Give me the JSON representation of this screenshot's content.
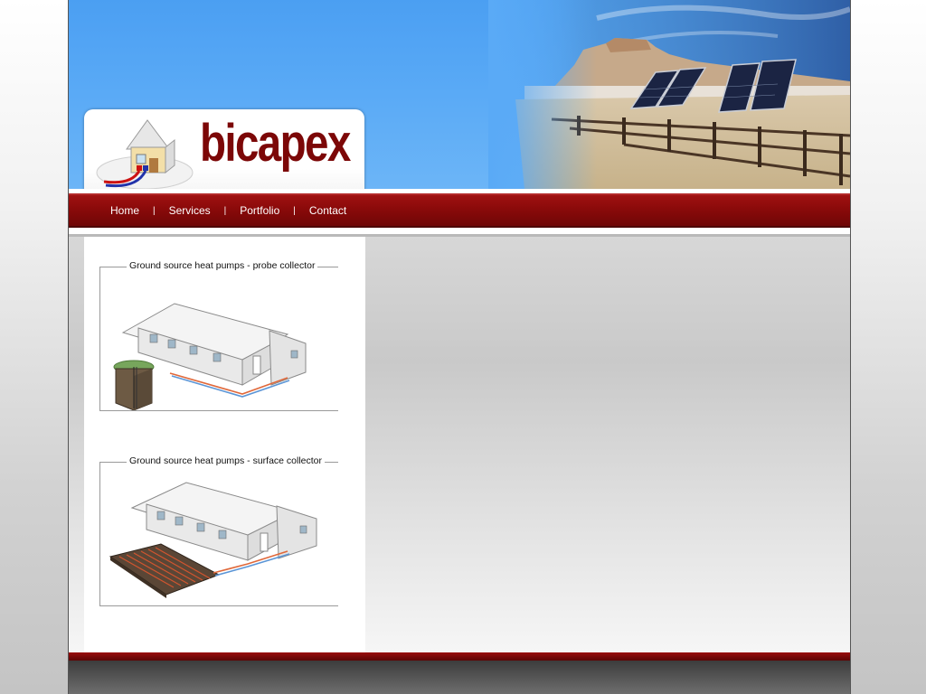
{
  "brand": {
    "name": "bicapex",
    "color": "#7c0707"
  },
  "nav": {
    "items": [
      {
        "label": "Home"
      },
      {
        "label": "Services"
      },
      {
        "label": "Portfolio"
      },
      {
        "label": "Contact"
      }
    ],
    "separator": "|"
  },
  "gallery": {
    "items": [
      {
        "caption": "Ground source heat pumps - probe collector",
        "icon": "house-probe-collector-illustration"
      },
      {
        "caption": "Ground source heat pumps - surface collector",
        "icon": "house-surface-collector-illustration"
      }
    ]
  },
  "header": {
    "photo": "solar-panels-desert-photo"
  },
  "colors": {
    "nav": "#8a0a0a",
    "sky": "#5aaaf6",
    "footer": "#4a4a4a"
  }
}
